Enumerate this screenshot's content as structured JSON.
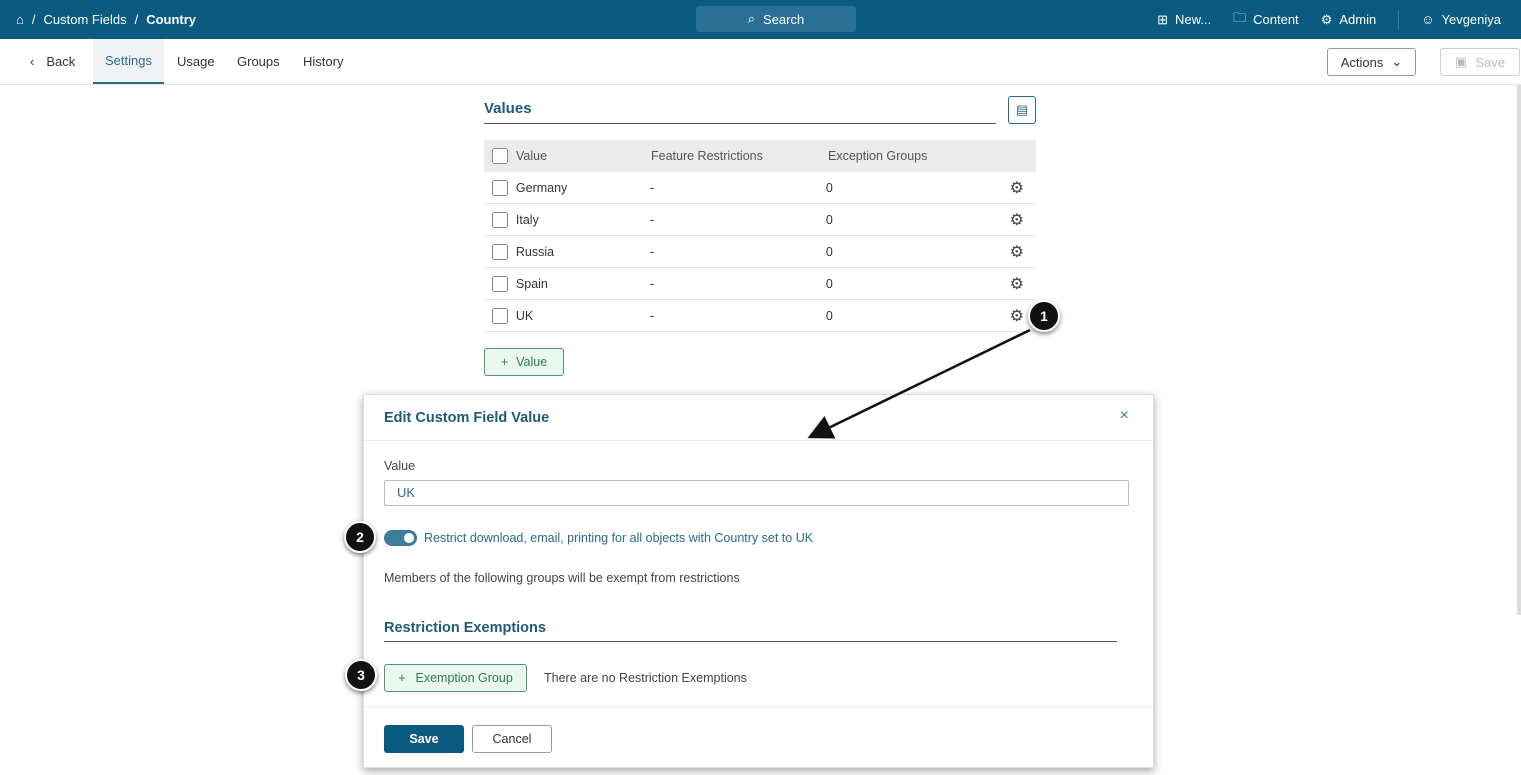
{
  "topbar": {
    "breadcrumb": [
      "Custom Fields",
      "Country"
    ],
    "search": "Search",
    "new": "New...",
    "content": "Content",
    "admin": "Admin",
    "user": "Yevgeniya"
  },
  "subnav": {
    "back": "Back",
    "tabs": [
      "Settings",
      "Usage",
      "Groups",
      "History"
    ],
    "actions": "Actions",
    "save": "Save"
  },
  "values": {
    "title": "Values",
    "headers": [
      "Value",
      "Feature Restrictions",
      "Exception Groups"
    ],
    "rows": [
      {
        "value": "Germany",
        "restrictions": "-",
        "groups": "0"
      },
      {
        "value": "Italy",
        "restrictions": "-",
        "groups": "0"
      },
      {
        "value": "Russia",
        "restrictions": "-",
        "groups": "0"
      },
      {
        "value": "Spain",
        "restrictions": "-",
        "groups": "0"
      },
      {
        "value": "UK",
        "restrictions": "-",
        "groups": "0"
      }
    ],
    "add_label": "Value"
  },
  "modal": {
    "title": "Edit Custom Field Value",
    "value_label": "Value",
    "value": "UK",
    "toggle_on": true,
    "toggle_label": "Restrict download, email, printing for all objects with Country set to UK",
    "members_text": "Members of the following groups will be exempt from restrictions",
    "exemptions_title": "Restriction Exemptions",
    "add_exemption": "Exemption Group",
    "no_exemptions": "There are no Restriction Exemptions",
    "save": "Save",
    "cancel": "Cancel"
  },
  "callouts": [
    "1",
    "2",
    "3"
  ]
}
